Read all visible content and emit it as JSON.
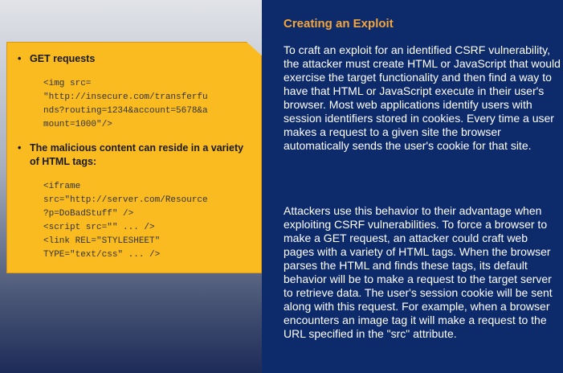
{
  "callout": {
    "bullets": [
      {
        "title": "GET requests",
        "code": "<img src=\n\"http://insecure.com/transferfu\nnds?routing=1234&account=5678&a\nmount=1000\"/>"
      },
      {
        "title": "The malicious content can reside in a variety of HTML tags:",
        "code": "<iframe\nsrc=\"http://server.com/Resource\n?p=DoBadStuff\" />\n<script src=\"\" ... />\n<link REL=\"STYLESHEET\"\nTYPE=\"text/css\" ... />"
      }
    ]
  },
  "article": {
    "heading": "Creating an Exploit",
    "paragraphs": [
      "To craft an exploit for an identified CSRF vulnerability, the attacker must create HTML or JavaScript that would exercise the target functionality and then find a way to have that HTML or JavaScript execute in their user's browser. Most web applications identify users with session identifiers stored in cookies. Every time a user makes a request to a given site the browser automatically sends the user's cookie for that site.",
      "Attackers use this behavior to their advantage when exploiting CSRF vulnerabilities. To force a browser to make a GET request, an attacker could craft web pages with a variety of HTML tags. When the browser parses the HTML and finds these tags, its default behavior will be to make a request to the target server to retrieve data. The user's session cookie will be sent along with this request. For example, when a browser encounters an image tag it will make a request to the URL specified in the \"src\" attribute."
    ]
  }
}
